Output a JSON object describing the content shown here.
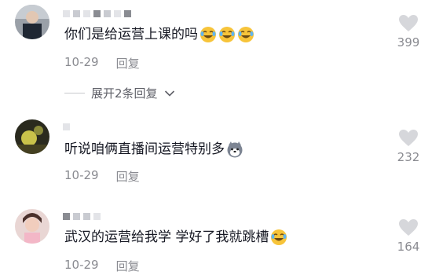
{
  "comments": [
    {
      "text": "你们是给运营上课的吗",
      "date": "10-29",
      "reply_label": "回复",
      "likes": "399",
      "emoji": [
        "laughing-crying-emoji",
        "laughing-crying-emoji",
        "laughing-crying-emoji"
      ]
    },
    {
      "text": "听说咱俩直播间运营特别多",
      "date": "10-29",
      "reply_label": "回复",
      "likes": "232",
      "emoji": [
        "husky-dog-emoji"
      ]
    },
    {
      "text": "武汉的运营给我学 学好了我就跳槽",
      "date": "10-29",
      "reply_label": "回复",
      "likes": "164",
      "emoji": [
        "laughing-crying-emoji"
      ]
    }
  ],
  "expand_replies": "展开2条回复",
  "colors": {
    "text": "#161823",
    "meta": "#8a8b91",
    "like_icon": "#d6d7db",
    "emoji_face": "#f7c43a"
  }
}
